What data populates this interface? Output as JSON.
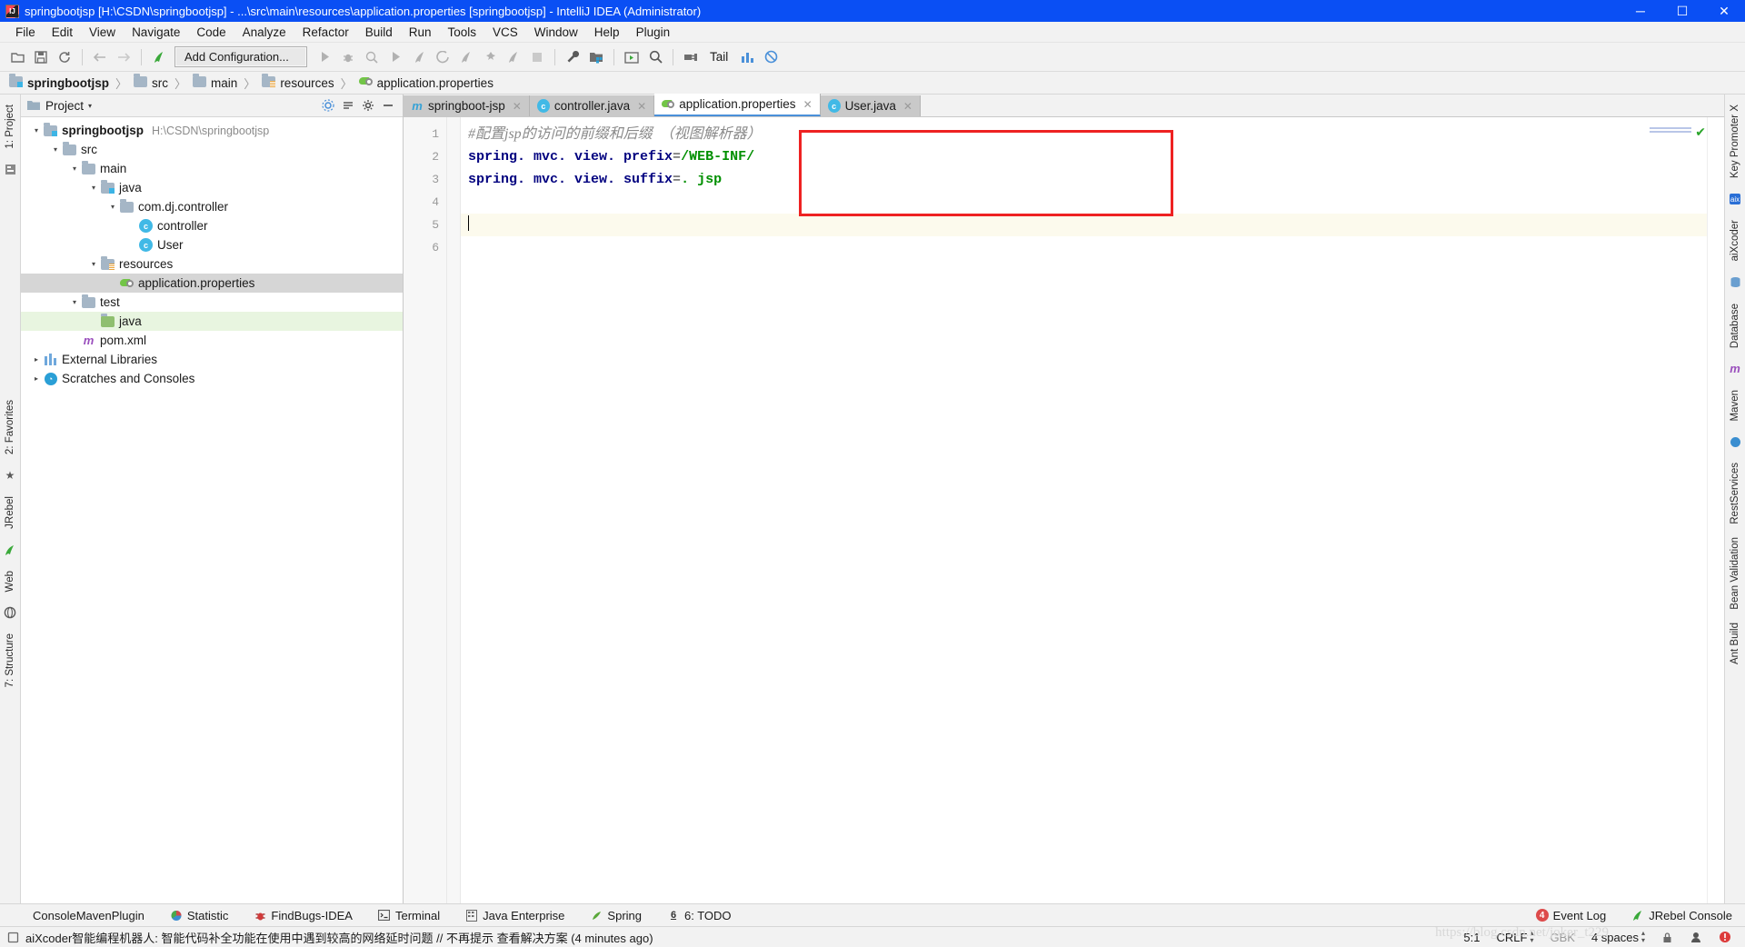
{
  "window": {
    "title": "springbootjsp [H:\\CSDN\\springbootjsp] - ...\\src\\main\\resources\\application.properties [springbootjsp] - IntelliJ IDEA (Administrator)",
    "minimize": "─",
    "maximize": "☐",
    "close": "✕",
    "icon": "intellij-idea-icon",
    "titlebar_color": "#0a4ff4"
  },
  "menubar": {
    "items": [
      "File",
      "Edit",
      "View",
      "Navigate",
      "Code",
      "Analyze",
      "Refactor",
      "Build",
      "Run",
      "Tools",
      "VCS",
      "Window",
      "Help",
      "Plugin"
    ]
  },
  "toolbar": {
    "run_config_label": "Add Configuration...",
    "tail_label": "Tail",
    "icons": [
      "open-folder-icon",
      "save-all-icon",
      "sync-icon",
      "back-arrow-icon",
      "forward-arrow-icon",
      "jrebel-icon",
      "run-icon",
      "debug-icon",
      "run-with-coverage-icon",
      "run-alt-icon",
      "jrebel-run-icon",
      "jrebel-debug-icon",
      "jrebel-run-jr-icon",
      "jrebel-debug-jr-icon",
      "jrebel-coverage-icon",
      "stop-icon",
      "settings-wrench-icon",
      "project-structure-icon",
      "console-icon",
      "search-everywhere-icon",
      "plug-icon",
      "tail-icon",
      "chart-icon",
      "disable-icon"
    ]
  },
  "breadcrumb": {
    "items": [
      {
        "label": "springbootjsp",
        "icon": "module-folder-icon",
        "bold": true
      },
      {
        "label": "src",
        "icon": "folder-icon",
        "bold": false
      },
      {
        "label": "main",
        "icon": "folder-icon",
        "bold": false
      },
      {
        "label": "resources",
        "icon": "resources-folder-icon",
        "bold": false
      },
      {
        "label": "application.properties",
        "icon": "properties-file-icon",
        "bold": false
      }
    ],
    "separator": "〉"
  },
  "left_strip": {
    "items": [
      "1: Project",
      "structure-icon",
      "2: Favorites",
      "favorites-star-icon",
      "JRebel",
      "jrebel-leaf-icon",
      "Web",
      "web-globe-icon",
      "7: Structure"
    ]
  },
  "right_strip": {
    "items": [
      "Key Promoter X",
      "aiXcoder",
      "Database",
      "Maven",
      "RestServices",
      "Bean Validation",
      "Ant Build"
    ]
  },
  "project_panel": {
    "title": "Project",
    "caret": "▾",
    "header_icons": [
      "project-scope-icon",
      "collapse-all-icon",
      "settings-gear-icon",
      "hide-icon"
    ],
    "tree": [
      {
        "depth": 0,
        "arrow": "▾",
        "icon": "module-folder-icon",
        "label": "springbootjsp",
        "bold": true,
        "path": "H:\\CSDN\\springbootjsp",
        "state": "normal"
      },
      {
        "depth": 1,
        "arrow": "▾",
        "icon": "folder-icon",
        "label": "src",
        "bold": false,
        "path": "",
        "state": "normal"
      },
      {
        "depth": 2,
        "arrow": "▾",
        "icon": "folder-icon",
        "label": "main",
        "bold": false,
        "path": "",
        "state": "normal"
      },
      {
        "depth": 3,
        "arrow": "▾",
        "icon": "source-folder-icon",
        "label": "java",
        "bold": false,
        "path": "",
        "state": "normal"
      },
      {
        "depth": 4,
        "arrow": "▾",
        "icon": "package-icon",
        "label": "com.dj.controller",
        "bold": false,
        "path": "",
        "state": "normal"
      },
      {
        "depth": 5,
        "arrow": "",
        "icon": "java-class-icon",
        "label": "controller",
        "bold": false,
        "path": "",
        "state": "normal"
      },
      {
        "depth": 5,
        "arrow": "",
        "icon": "java-class-icon",
        "label": "User",
        "bold": false,
        "path": "",
        "state": "normal"
      },
      {
        "depth": 3,
        "arrow": "▾",
        "icon": "resources-folder-icon",
        "label": "resources",
        "bold": false,
        "path": "",
        "state": "normal"
      },
      {
        "depth": 4,
        "arrow": "",
        "icon": "properties-file-icon",
        "label": "application.properties",
        "bold": false,
        "path": "",
        "state": "selected"
      },
      {
        "depth": 2,
        "arrow": "▾",
        "icon": "folder-icon",
        "label": "test",
        "bold": false,
        "path": "",
        "state": "normal"
      },
      {
        "depth": 3,
        "arrow": "",
        "icon": "test-source-folder-icon",
        "label": "java",
        "bold": false,
        "path": "",
        "state": "green"
      },
      {
        "depth": 2,
        "arrow": "",
        "icon": "maven-pom-icon",
        "label": "pom.xml",
        "bold": false,
        "path": "",
        "state": "normal"
      },
      {
        "depth": 0,
        "arrow": "▸",
        "icon": "libraries-icon",
        "label": "External Libraries",
        "bold": false,
        "path": "",
        "state": "normal"
      },
      {
        "depth": 0,
        "arrow": "▸",
        "icon": "scratches-icon",
        "label": "Scratches and Consoles",
        "bold": false,
        "path": "",
        "state": "normal"
      }
    ]
  },
  "editor": {
    "tabs": [
      {
        "label": "springboot-jsp",
        "icon": "maven-module-icon",
        "active": false,
        "close": "✕"
      },
      {
        "label": "controller.java",
        "icon": "java-class-icon",
        "active": false,
        "close": "✕"
      },
      {
        "label": "application.properties",
        "icon": "properties-file-icon",
        "active": true,
        "close": "✕"
      },
      {
        "label": "User.java",
        "icon": "java-class-icon",
        "active": false,
        "close": "✕"
      }
    ],
    "line_numbers": [
      "1",
      "2",
      "3",
      "4",
      "5",
      "6"
    ],
    "lines": [
      {
        "n": 1,
        "type": "comment",
        "text": "#配置jsp的访问的前缀和后缀  （视图解析器）"
      },
      {
        "n": 2,
        "type": "property",
        "key": "spring. mvc. view. prefix",
        "eq": "=",
        "value": "/WEB-INF/"
      },
      {
        "n": 3,
        "type": "property",
        "key": "spring. mvc. view. suffix",
        "eq": "=",
        "value": ". jsp"
      },
      {
        "n": 4,
        "type": "blank",
        "text": ""
      },
      {
        "n": 5,
        "type": "caret",
        "text": ""
      },
      {
        "n": 6,
        "type": "blank",
        "text": ""
      }
    ],
    "inspection_ok": "✔",
    "highlight_box_color": "#ee2222"
  },
  "bottom_tool_windows": [
    {
      "label": "ConsoleMavenPlugin",
      "icon": "console-maven-icon"
    },
    {
      "label": "Statistic",
      "icon": "statistic-icon"
    },
    {
      "label": "FindBugs-IDEA",
      "icon": "findbugs-icon"
    },
    {
      "label": "Terminal",
      "icon": "terminal-icon"
    },
    {
      "label": "Java Enterprise",
      "icon": "java-enterprise-icon"
    },
    {
      "label": "Spring",
      "icon": "spring-leaf-icon"
    },
    {
      "label": "6: TODO",
      "icon": "todo-icon"
    }
  ],
  "bottom_right_tools": [
    {
      "label": "Event Log",
      "icon": "event-log-icon",
      "badge": "4"
    },
    {
      "label": "JRebel Console",
      "icon": "jrebel-icon",
      "badge": ""
    }
  ],
  "statusbar": {
    "message_icon": "notification-icon",
    "message": "aiXcoder智能编程机器人: 智能代码补全功能在使用中遇到较高的网络延时问题 // 不再提示 查看解决方案 (4 minutes ago)",
    "caret_position": "5:1",
    "line_separator": "CRLF",
    "encoding": "GBK",
    "indent": "4 spaces",
    "lock_icon": "lock-icon",
    "inspector_icon": "inspector-icon",
    "error_icon": "error-icon",
    "watermark": "https://blog.csdn.net/joker_t229"
  }
}
